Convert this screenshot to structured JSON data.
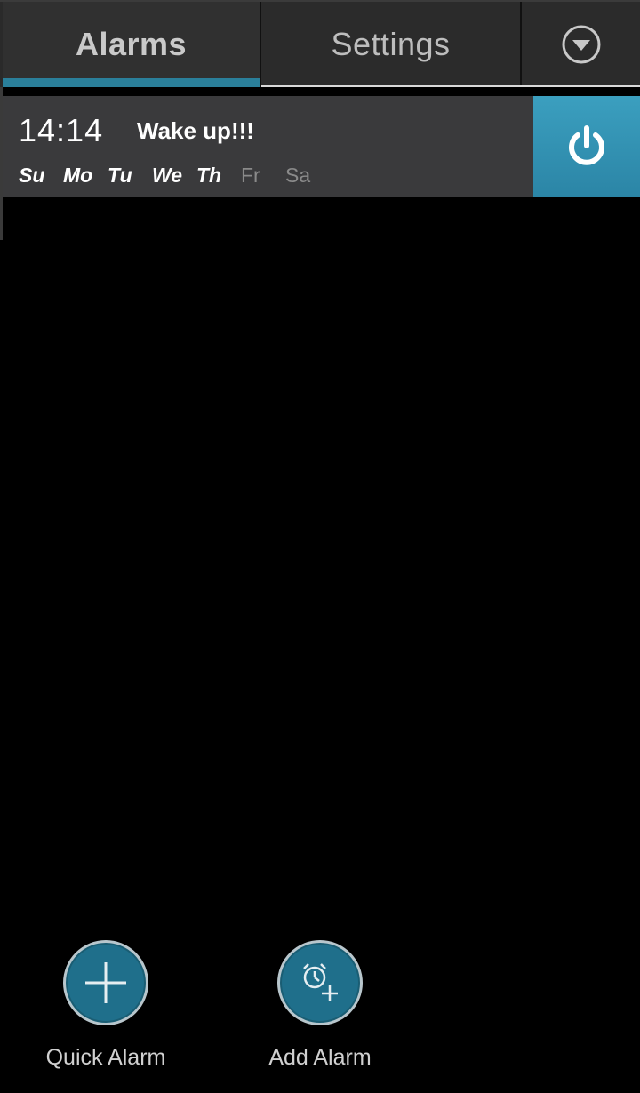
{
  "tabs": {
    "alarms_label": "Alarms",
    "settings_label": "Settings",
    "menu_icon": "chevron-down-circle-icon"
  },
  "alarm": {
    "time": "14:14",
    "title": "Wake up!!!",
    "days": [
      {
        "label": "Su",
        "active": true
      },
      {
        "label": "Mo",
        "active": true
      },
      {
        "label": "Tu",
        "active": true
      },
      {
        "label": "We",
        "active": true
      },
      {
        "label": "Th",
        "active": true
      },
      {
        "label": "Fr",
        "active": false
      },
      {
        "label": "Sa",
        "active": false
      }
    ],
    "power_icon": "power-icon",
    "enabled": true
  },
  "actions": {
    "quick_alarm_label": "Quick Alarm",
    "add_alarm_label": "Add Alarm",
    "quick_alarm_icon": "plus-icon",
    "add_alarm_icon": "alarm-add-icon"
  },
  "colors": {
    "accent": "#2a7f9a",
    "power_bg": "#2b85a6",
    "fab_bg": "#1f6f8b",
    "active_day": "#ffffff",
    "inactive_day": "#8a8a8a"
  }
}
